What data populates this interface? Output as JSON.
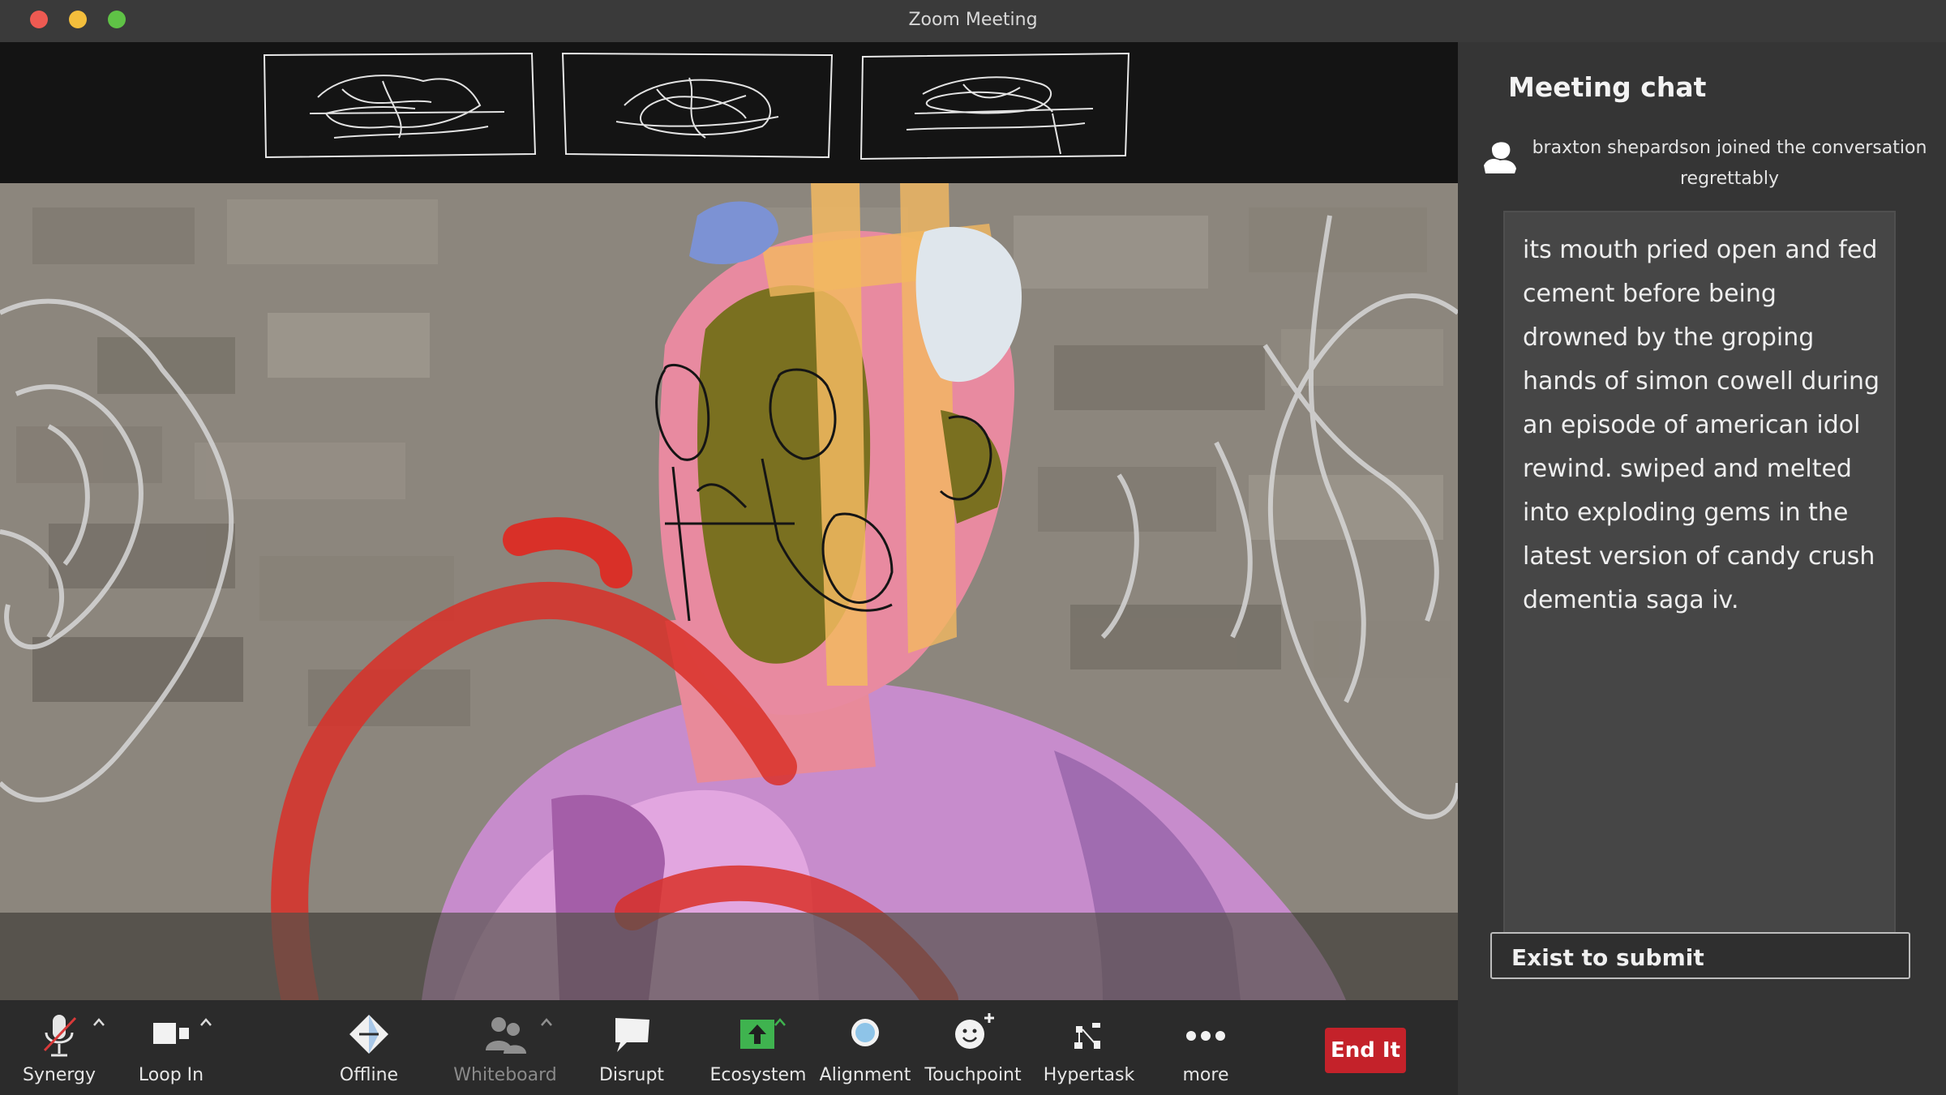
{
  "window": {
    "title": "Zoom Meeting"
  },
  "chat": {
    "title": "Meeting chat",
    "join_line1": "braxton shepardson  joined the conversation",
    "join_line2": "regrettably",
    "message": "its mouth pried open and fed cement before being drowned by the groping hands of simon cowell during an episode of american idol rewind. swiped and melted into exploding gems in the latest version of candy crush dementia saga iv.",
    "input_placeholder": "Exist to submit"
  },
  "toolbar": {
    "synergy": "Synergy",
    "loop_in": "Loop In",
    "offline": "Offline",
    "whiteboard": "Whiteboard",
    "disrupt": "Disrupt",
    "ecosystem": "Ecosystem",
    "alignment": "Alignment",
    "touchpoint": "Touchpoint",
    "hypertask": "Hypertask",
    "more": "more",
    "end": "End It"
  },
  "colors": {
    "end_button": "#c4222a",
    "ecosystem_icon": "#3fb34f",
    "mic_muted_slash": "#d93a3a"
  },
  "icons": {
    "synergy": "muted-microphone-icon",
    "loop_in": "video-camera-icon",
    "offline": "share-diamond-icon",
    "whiteboard": "participants-icon",
    "disrupt": "speech-bubble-icon",
    "ecosystem": "upload-arrow-icon",
    "alignment": "circle-icon",
    "touchpoint": "smiley-plus-icon",
    "hypertask": "apps-icon",
    "more": "ellipsis-icon"
  }
}
